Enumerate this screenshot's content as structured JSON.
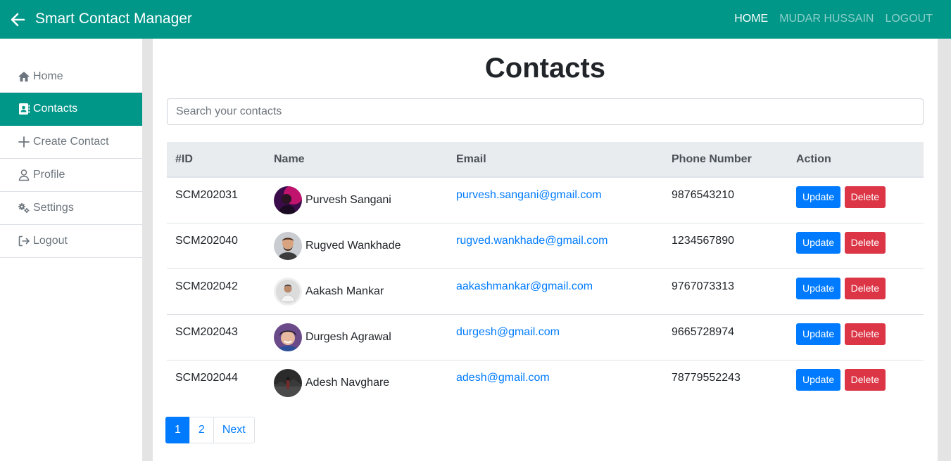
{
  "navbar": {
    "brand": "Smart Contact Manager",
    "home": "HOME",
    "user": "MUDAR HUSSAIN",
    "logout": "LOGOUT",
    "color": "#009688"
  },
  "sidebar": {
    "items": [
      {
        "label": "Home",
        "icon": "home-icon"
      },
      {
        "label": "Contacts",
        "icon": "contacts-icon",
        "active": true
      },
      {
        "label": "Create Contact",
        "icon": "plus-icon"
      },
      {
        "label": "Profile",
        "icon": "user-icon"
      },
      {
        "label": "Settings",
        "icon": "gears-icon"
      },
      {
        "label": "Logout",
        "icon": "sign-out-icon"
      }
    ]
  },
  "main": {
    "title": "Contacts",
    "search_placeholder": "Search your contacts",
    "table": {
      "headers": [
        "#ID",
        "Name",
        "Email",
        "Phone Number",
        "Action"
      ],
      "rows": [
        {
          "id": "SCM202031",
          "name": "Purvesh Sangani",
          "email": "purvesh.sangani@gmail.com",
          "phone": "9876543210"
        },
        {
          "id": "SCM202040",
          "name": "Rugved Wankhade",
          "email": "rugved.wankhade@gmail.com",
          "phone": "1234567890"
        },
        {
          "id": "SCM202042",
          "name": "Aakash Mankar",
          "email": "aakashmankar@gmail.com",
          "phone": "9767073313"
        },
        {
          "id": "SCM202043",
          "name": "Durgesh Agrawal",
          "email": "durgesh@gmail.com",
          "phone": "9665728974"
        },
        {
          "id": "SCM202044",
          "name": "Adesh Navghare",
          "email": "adesh@gmail.com",
          "phone": "78779552243"
        }
      ],
      "update_label": "Update",
      "delete_label": "Delete"
    },
    "pagination": {
      "pages": [
        "1",
        "2"
      ],
      "current": "1",
      "next": "Next"
    }
  }
}
